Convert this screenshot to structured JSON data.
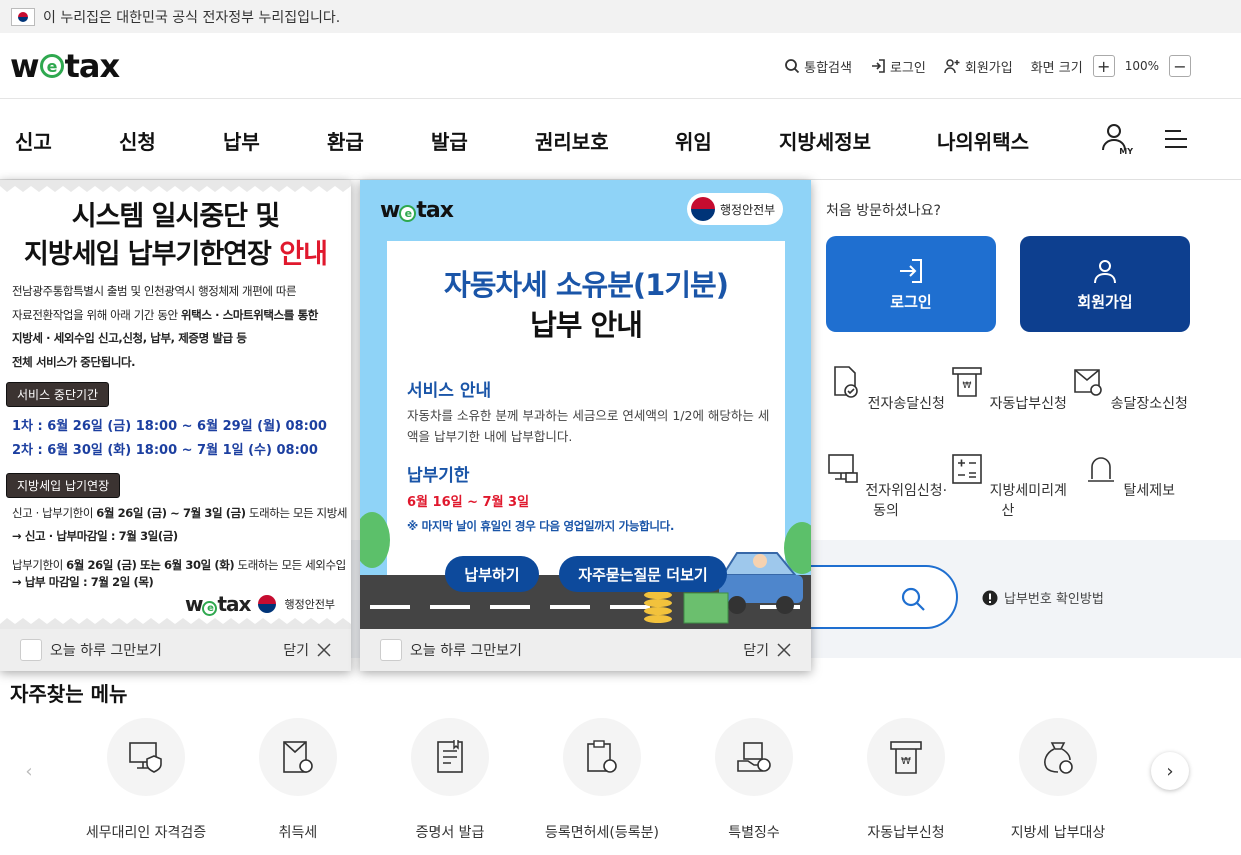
{
  "gov_banner": {
    "text": "이 누리집은 대한민국 공식 전자정부 누리집입니다."
  },
  "header": {
    "logo": {
      "pre": "w",
      "e": "e",
      "post": "tax"
    },
    "search": "통합검색",
    "login": "로그인",
    "signup": "회원가입",
    "screen_size": "화면 크기",
    "zoom_in": "+",
    "zoom_value": "100%",
    "zoom_out": "−"
  },
  "gnb": {
    "items": [
      "신고",
      "신청",
      "납부",
      "환급",
      "발급",
      "권리보호",
      "위임",
      "지방세정보",
      "나의위택스"
    ],
    "my_label": "MY"
  },
  "side": {
    "question": "처음 방문하셨나요?",
    "login_btn": "로그인",
    "signup_btn": "회원가입",
    "quick": [
      "전자송달신청",
      "자동납부신청",
      "송달장소신청",
      "전자위임신청·동의",
      "지방세미리계산",
      "탈세제보"
    ]
  },
  "search": {
    "hint": "납부번호 확인방법"
  },
  "favorites": {
    "title": "자주찾는 메뉴",
    "items": [
      "세무대리인 자격검증",
      "취득세",
      "증명서 발급",
      "등록면허세(등록분)",
      "특별징수",
      "자동납부신청",
      "지방세 납부대상"
    ],
    "prev": "‹",
    "next": "›"
  },
  "popup1": {
    "title_l1": "시스템 일시중단 및",
    "title_l2_a": "지방세입 납부기한연장 ",
    "title_l2_b": "안내",
    "desc_l1": "전남광주통합특별시 출범 및 인천광역시 행정체제 개편에 따른",
    "desc_l2_a": "자료전환작업을 위해 아래 기간 동안 ",
    "desc_l2_b": "위택스 · 스마트위택스를 통한",
    "desc_l3": "지방세 · 세외수입 신고,신청, 납부, 제증명 발급 등",
    "desc_l4": "전체 서비스가 중단됩니다.",
    "tag1": "서비스 중단기간",
    "sched1": "1차 : 6월 26일 (금) 18:00 ~ 6월 29일 (월) 08:00",
    "sched2": "2차 : 6월 30일 (화) 18:00 ~ 7월 1일 (수) 08:00",
    "tag2": "지방세입 납기연장",
    "ext1_a": "신고 · 납부기한이 ",
    "ext1_b": "6월 26일 (금) ~ 7월 3일 (금)",
    "ext1_c": " 도래하는 모든 지방세",
    "ext1_arrow": "→ 신고 · 납부마감일 : 7월 3일(금)",
    "ext2_a": "납부기한이 ",
    "ext2_b": "6월 26일 (금) 또는 6월 30일 (화)",
    "ext2_c": " 도래하는 모든 세외수입",
    "ext2_arrow": "→ 납부 마감일 : 7월 2일 (목)",
    "ministry": "행정안전부",
    "no_today": "오늘 하루 그만보기",
    "close": "닫기"
  },
  "popup2": {
    "ministry": "행정안전부",
    "title_l1": "자동차세 소유분(1기분)",
    "title_l2": "납부 안내",
    "sec1": "서비스 안내",
    "txt1": "자동차를 소유한 분께 부과하는 세금으로 연세액의 1/2에 해당하는 세액을 납부기한 내에 납부합니다.",
    "sec2": "납부기한",
    "period": "6월 16일 ~ 7월 3일",
    "note": "※ 마지막 날이 휴일인 경우 다음 영업일까지 가능합니다.",
    "pay_btn": "납부하기",
    "faq_btn": "자주묻는질문 더보기",
    "no_today": "오늘 하루 그만보기",
    "close": "닫기"
  },
  "colors": {
    "primary": "#1f6fd0",
    "navy": "#0d3f8f",
    "accent_red": "#e0182d",
    "green": "#2fa84f"
  }
}
